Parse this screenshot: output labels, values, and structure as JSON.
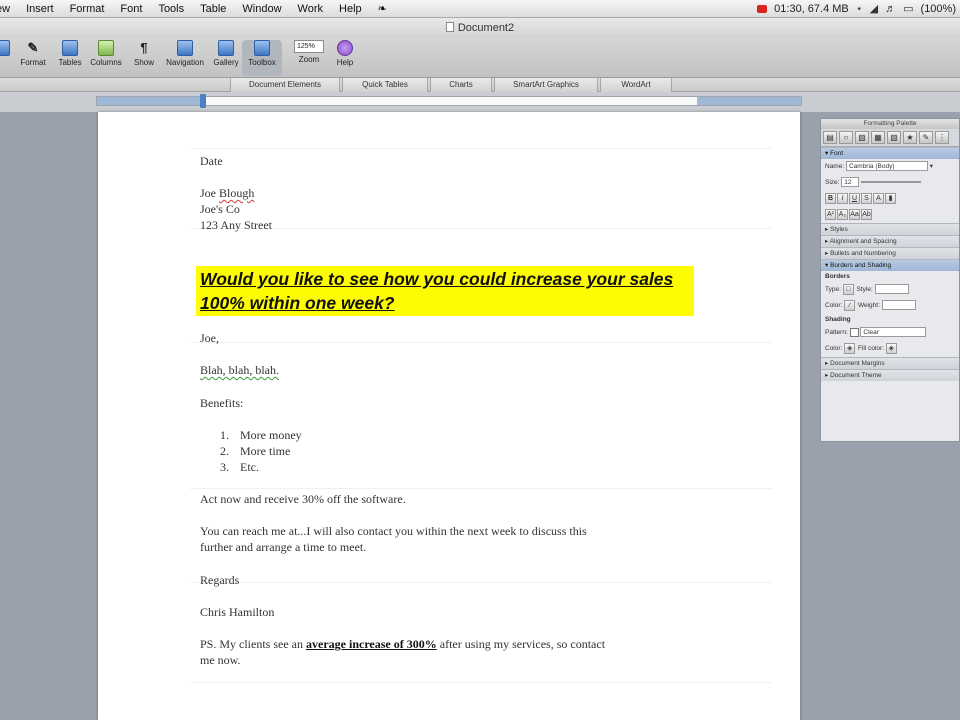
{
  "menubar": {
    "items": [
      "ew",
      "Insert",
      "Format",
      "Font",
      "Tools",
      "Table",
      "Window",
      "Work",
      "Help"
    ],
    "status_text": "01:30, 67.4 MB",
    "battery_text": "(100%)"
  },
  "window": {
    "title": "Document2"
  },
  "toolbar": {
    "buttons": [
      {
        "label": "",
        "icon": "partial-icon"
      },
      {
        "label": "Format",
        "icon": "format-brush-icon"
      },
      {
        "label": "Tables",
        "icon": "tables-icon"
      },
      {
        "label": "Columns",
        "icon": "columns-icon"
      },
      {
        "label": "Show",
        "icon": "pilcrow-icon"
      },
      {
        "label": "Navigation",
        "icon": "navigation-icon"
      },
      {
        "label": "Gallery",
        "icon": "gallery-icon"
      },
      {
        "label": "Toolbox",
        "icon": "toolbox-icon"
      },
      {
        "label": "Zoom",
        "icon": "zoom-field"
      },
      {
        "label": "Help",
        "icon": "help-icon"
      }
    ],
    "zoom_value": "125%"
  },
  "ribbon": {
    "tabs": [
      "Document Elements",
      "Quick Tables",
      "Charts",
      "SmartArt Graphics",
      "WordArt"
    ]
  },
  "document": {
    "date": "Date",
    "recipient_name_first": "Joe ",
    "recipient_name_last": "Blough",
    "company": "Joe's Co",
    "street": "123 Any Street",
    "headline": "Would you like to see how you could increase your sales 100% within one week?",
    "salutation": "Joe,",
    "body_filler": "Blah, blah, blah.",
    "benefits_heading": "Benefits:",
    "benefits": [
      {
        "num": "1.",
        "text": "More money"
      },
      {
        "num": "2.",
        "text": "More time"
      },
      {
        "num": "3.",
        "text": "Etc."
      }
    ],
    "offer": "Act now and receive 30% off the software.",
    "contact_line1": "You can reach me at...I will also contact you within the next week to discuss this",
    "contact_line2": "further and arrange a time to meet.",
    "closing": "Regards",
    "signature": "Chris Hamilton",
    "ps_start": "PS. My clients see an ",
    "ps_highlight": "average increase of 300%",
    "ps_end": " after using my services, so contact",
    "ps_line2": "me now."
  },
  "palette": {
    "title": "Formatting Palette",
    "font_section": "Font",
    "name_label": "Name:",
    "name_value": "Cambria (Body)",
    "size_label": "Size:",
    "size_value": "12",
    "sections": [
      "Styles",
      "Alignment and Spacing",
      "Bullets and Numbering"
    ],
    "borders_section": "Borders and Shading",
    "borders_sub": "Borders",
    "type_label": "Type:",
    "style_label": "Style:",
    "color_label": "Color:",
    "weight_label": "Weight:",
    "shading_sub": "Shading",
    "pattern_label": "Pattern:",
    "pattern_value": "Clear",
    "fill_label": "Fill color:",
    "bottom_sections": [
      "Document Margins",
      "Document Theme"
    ]
  }
}
